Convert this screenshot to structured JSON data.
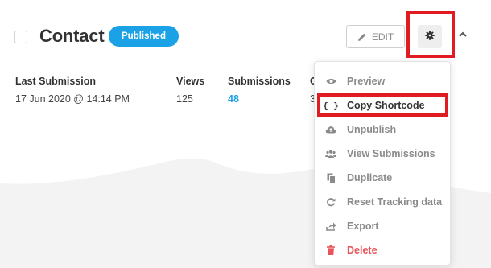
{
  "form": {
    "title": "Contact",
    "status_badge": "Published"
  },
  "actions": {
    "edit_label": "EDIT"
  },
  "stats": {
    "headers": [
      "Last Submission",
      "Views",
      "Submissions",
      "C"
    ],
    "values": [
      "17 Jun 2020 @ 14:14 PM",
      "125",
      "48",
      "3"
    ]
  },
  "menu": {
    "items": [
      {
        "label": "Preview",
        "icon": "eye-icon"
      },
      {
        "label": "Copy Shortcode",
        "icon": "braces-icon"
      },
      {
        "label": "Unpublish",
        "icon": "cloud-icon"
      },
      {
        "label": "View Submissions",
        "icon": "users-icon"
      },
      {
        "label": "Duplicate",
        "icon": "copy-icon"
      },
      {
        "label": "Reset Tracking data",
        "icon": "refresh-icon"
      },
      {
        "label": "Export",
        "icon": "export-icon"
      },
      {
        "label": "Delete",
        "icon": "trash-icon"
      }
    ]
  },
  "colors": {
    "accent": "#1aa1e6",
    "highlight": "#e11b22",
    "danger": "#e8545a"
  }
}
